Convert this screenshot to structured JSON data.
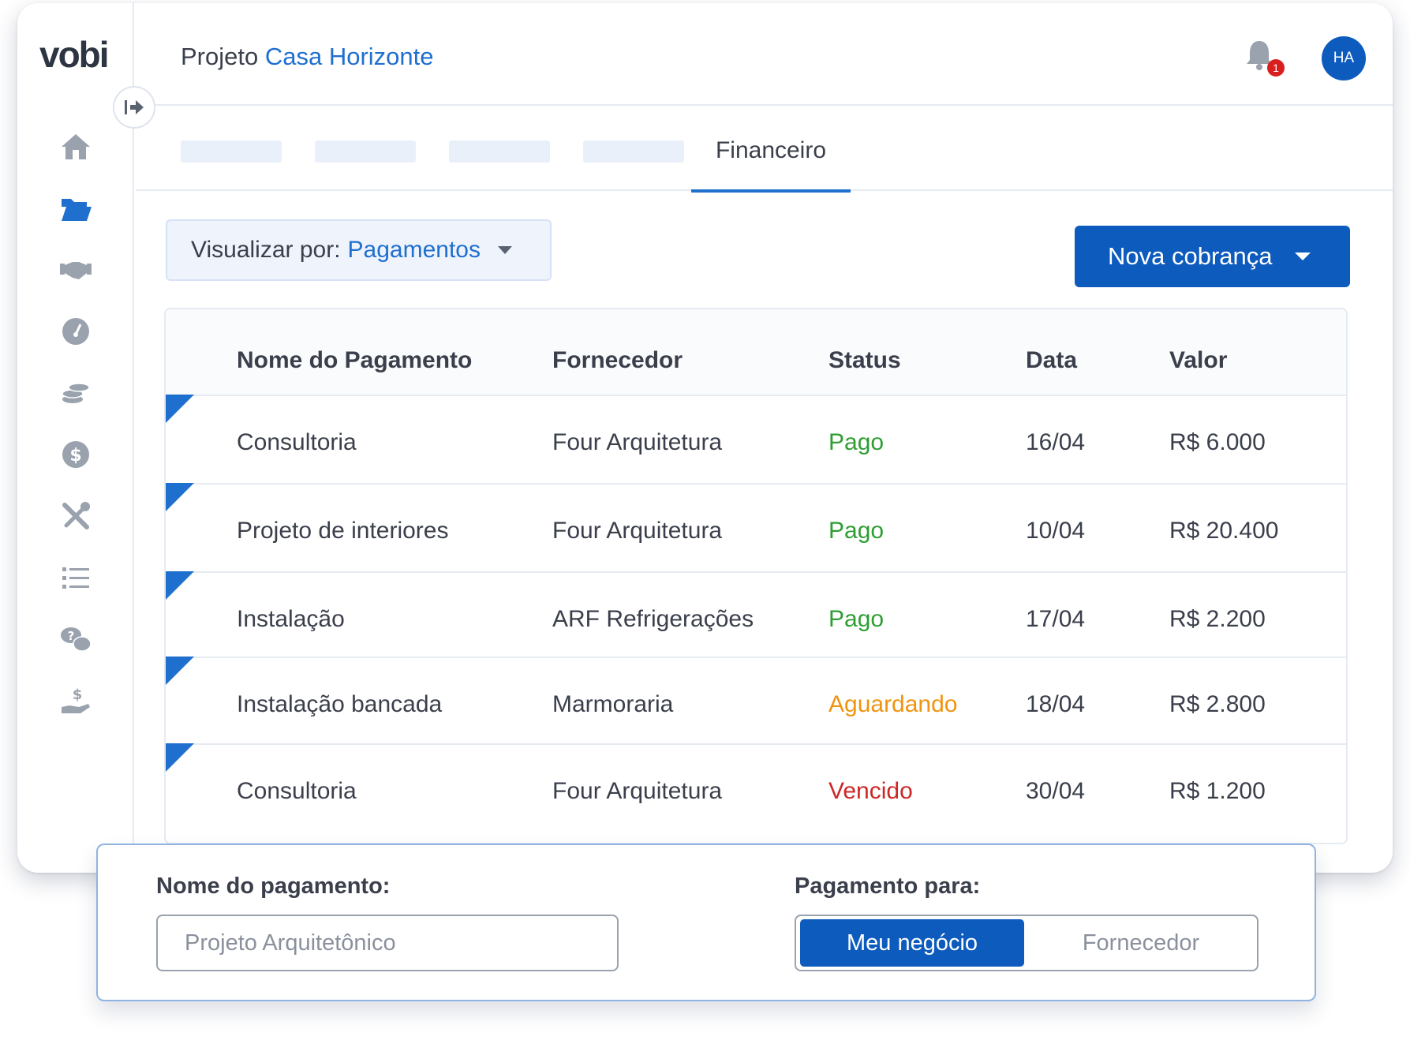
{
  "app": {
    "logo": "vobi",
    "project_prefix": "Projeto",
    "project_name": "Casa Horizonte",
    "notification_count": "1",
    "user_initials": "HA"
  },
  "sidebar": {
    "items": [
      {
        "icon": "home-icon"
      },
      {
        "icon": "folder-icon"
      },
      {
        "icon": "handshake-icon"
      },
      {
        "icon": "gauge-icon"
      },
      {
        "icon": "coins-icon"
      },
      {
        "icon": "dollar-circle-icon"
      },
      {
        "icon": "tools-icon"
      },
      {
        "icon": "list-icon"
      },
      {
        "icon": "help-chat-icon"
      },
      {
        "icon": "hand-money-icon"
      }
    ]
  },
  "tabs": {
    "active_label": "Financeiro"
  },
  "toolbar": {
    "view_label": "Visualizar por:",
    "view_value": "Pagamentos",
    "new_charge_label": "Nova cobrança"
  },
  "table": {
    "columns": [
      "Nome do Pagamento",
      "Fornecedor",
      "Status",
      "Data",
      "Valor"
    ],
    "rows": [
      {
        "name": "Consultoria",
        "supplier": "Four Arquitetura",
        "status": "Pago",
        "date": "16/04",
        "value": "R$ 6.000"
      },
      {
        "name": "Projeto de interiores",
        "supplier": "Four Arquitetura",
        "status": "Pago",
        "date": "10/04",
        "value": "R$ 20.400"
      },
      {
        "name": "Instalação",
        "supplier": "ARF Refrigerações",
        "status": "Pago",
        "date": "17/04",
        "value": "R$ 2.200"
      },
      {
        "name": "Instalação bancada",
        "supplier": "Marmoraria",
        "status": "Aguardando",
        "date": "18/04",
        "value": "R$ 2.800"
      },
      {
        "name": "Consultoria",
        "supplier": "Four Arquitetura",
        "status": "Vencido",
        "date": "30/04",
        "value": "R$ 1.200"
      }
    ]
  },
  "form": {
    "name_label": "Nome do pagamento:",
    "name_placeholder": "Projeto Arquitetônico",
    "payment_to_label": "Pagamento para:",
    "option_mine": "Meu negócio",
    "option_supplier": "Fornecedor"
  },
  "colors": {
    "brand_blue": "#0d5bbd",
    "accent_blue": "#1f6fcf",
    "status_paid": "#2e9e33",
    "status_waiting": "#f0940f",
    "status_overdue": "#cc2727"
  }
}
